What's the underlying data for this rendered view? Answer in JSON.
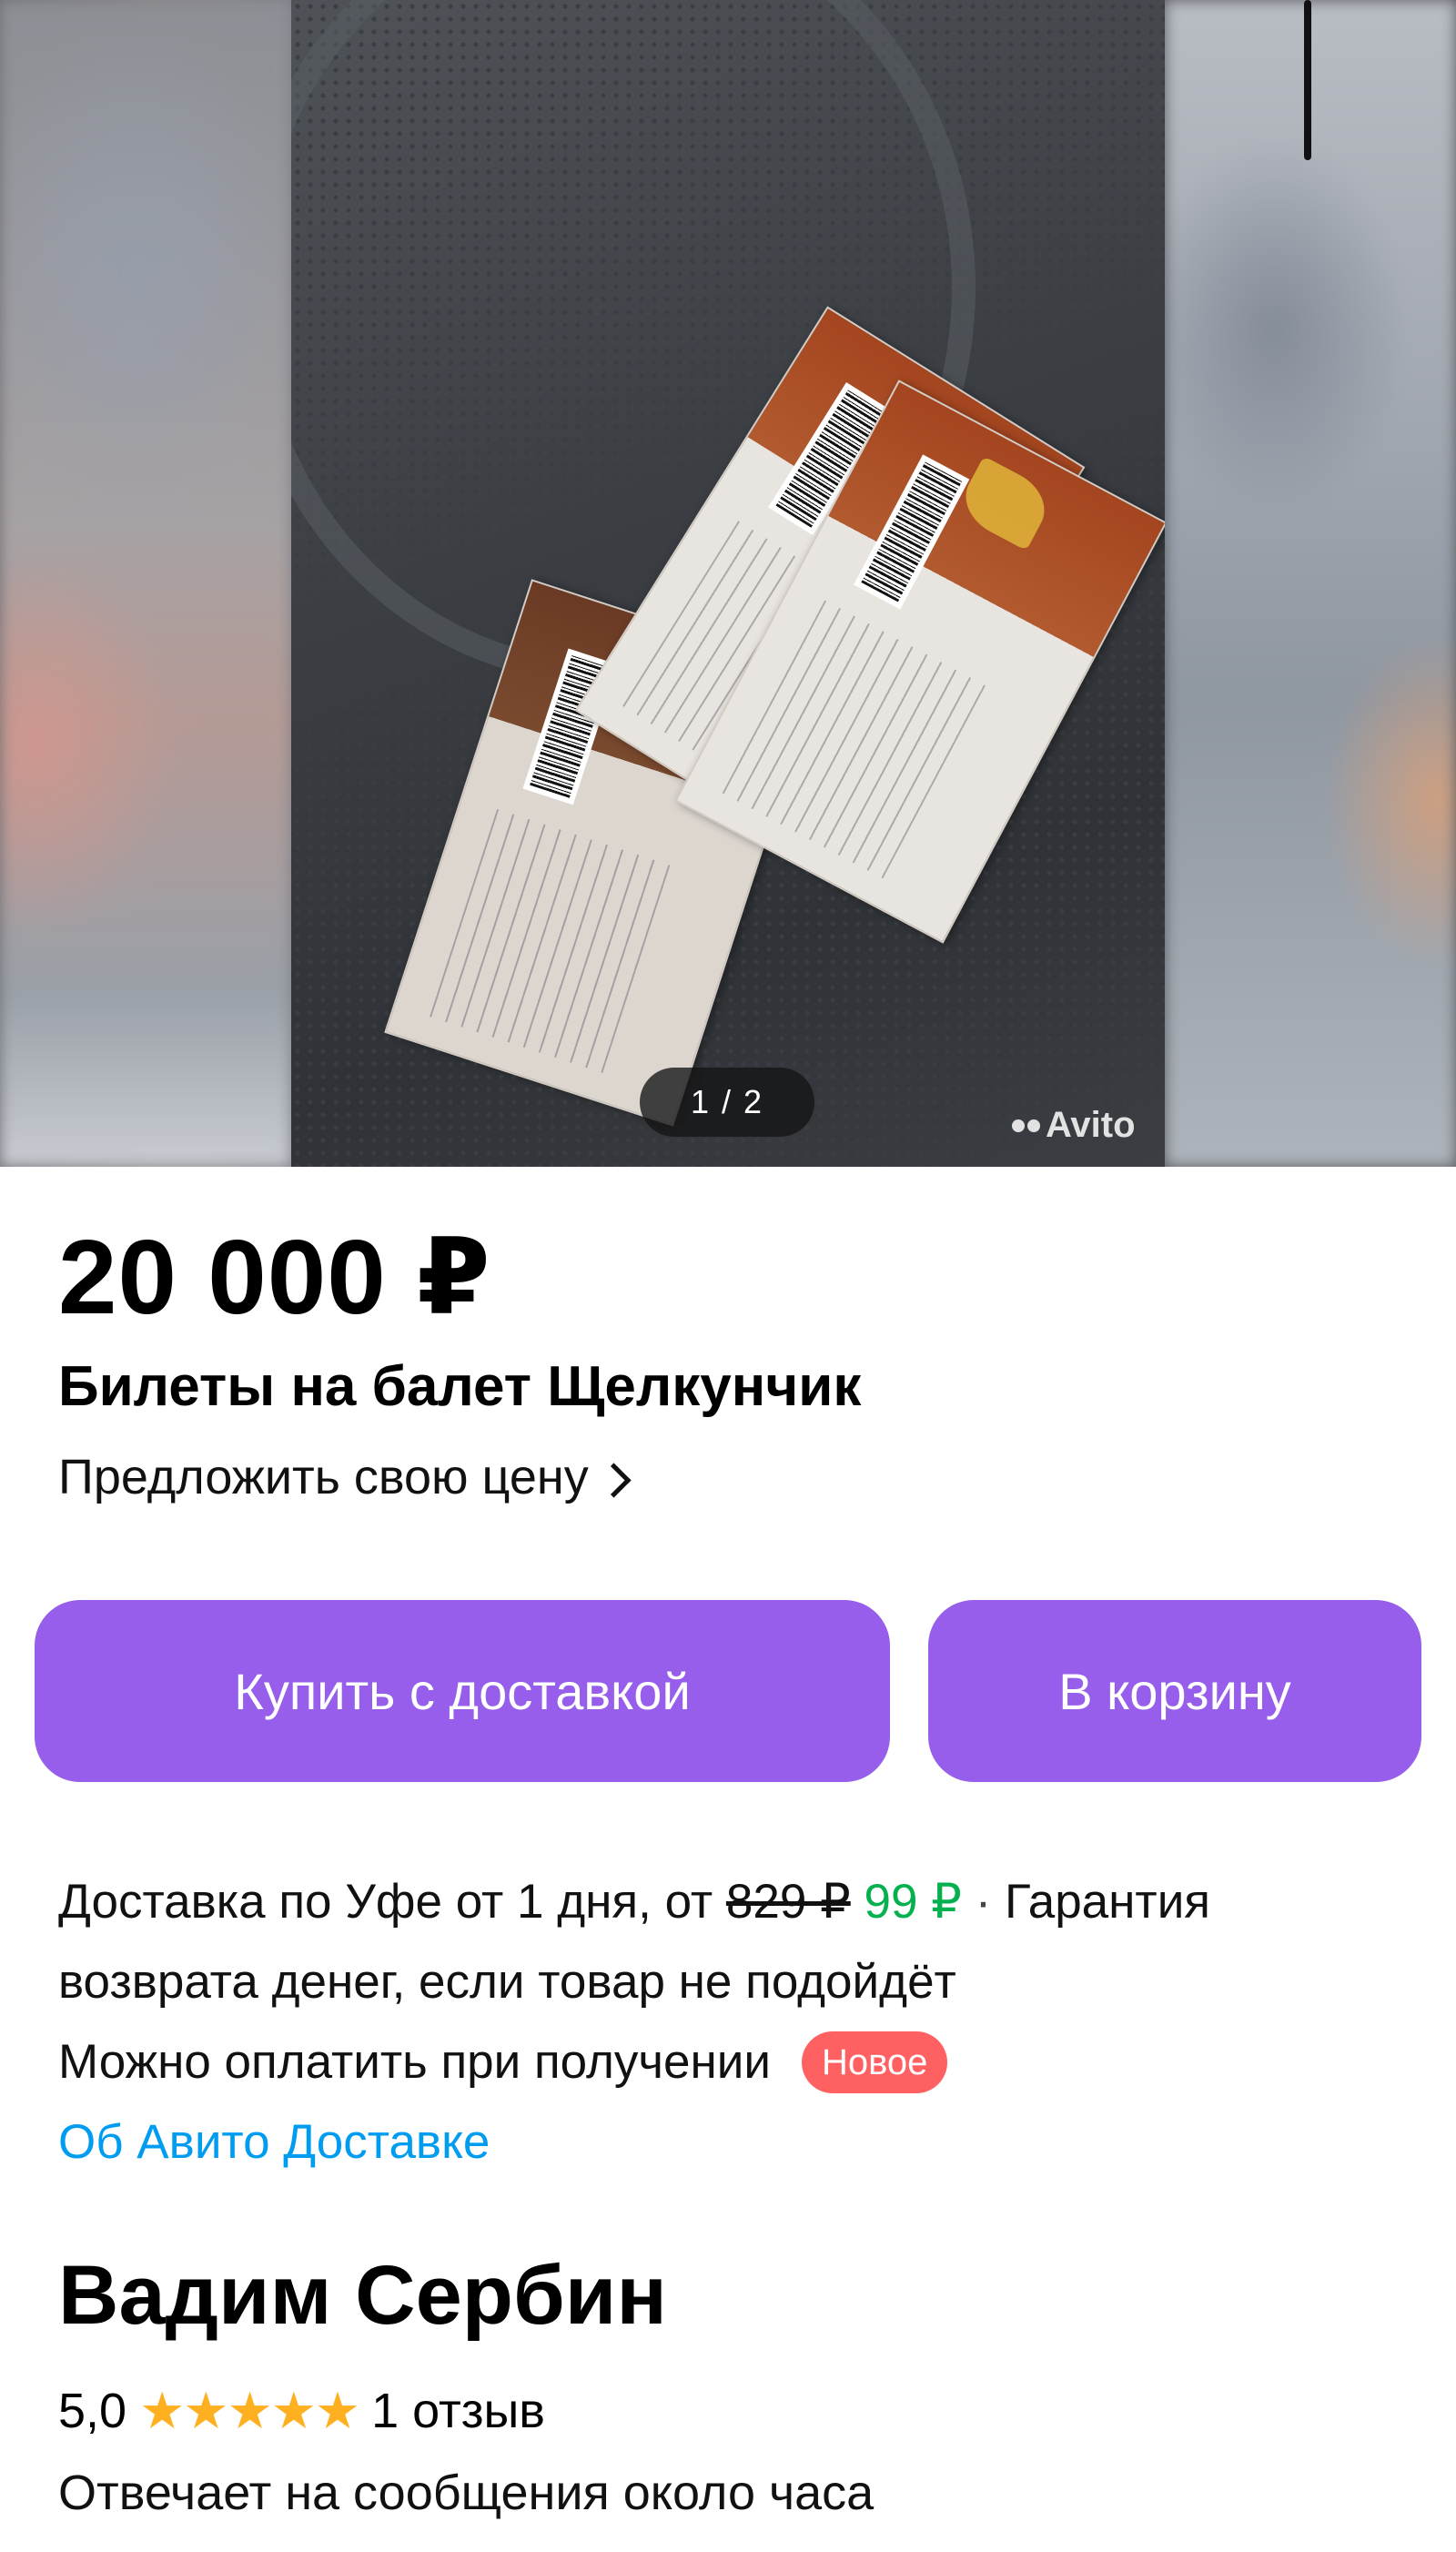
{
  "gallery": {
    "counter": "1 / 2",
    "watermark": "Avito"
  },
  "listing": {
    "price": "20 000 ₽",
    "title": "Билеты на балет Щелкунчик",
    "offer_label": "Предложить свою цену"
  },
  "actions": {
    "buy_label": "Купить с доставкой",
    "cart_label": "В корзину"
  },
  "delivery": {
    "text_start": "Доставка по Уфе от 1 дня, от ",
    "old_price": "829 ₽",
    "new_price": "99 ₽",
    "separator": " · ",
    "guarantee": "Гарантия возврата денег, если товар не подойдёт",
    "pay_on_receipt": "Можно оплатить при получении",
    "badge": "Новое",
    "about_link": "Об Авито Доставке"
  },
  "seller": {
    "name": "Вадим Сербин",
    "rating": "5,0",
    "stars": "★★★★★",
    "stars_value": 5,
    "reviews": "1 отзыв",
    "response_time": "Отвечает на сообщения около часа"
  },
  "colors": {
    "button": "#965eeb",
    "new_price": "#04b14e",
    "badge": "#ff6163",
    "link": "#009cf0",
    "star": "#ffb021"
  }
}
